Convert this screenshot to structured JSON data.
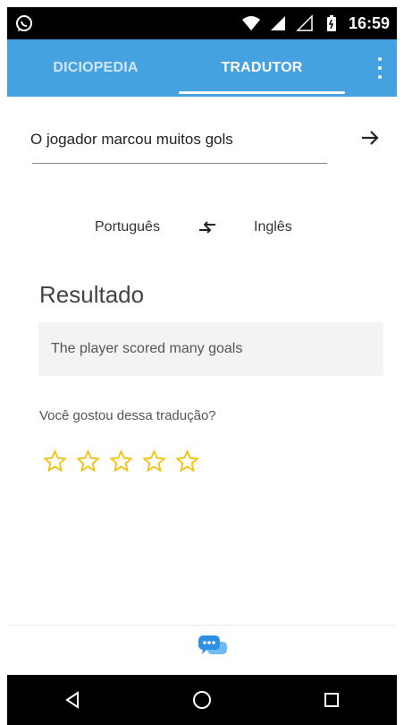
{
  "status_bar": {
    "time": "16:59",
    "icons": [
      "whatsapp-icon",
      "wifi-icon",
      "signal-icon",
      "empty-signal-icon",
      "battery-icon"
    ]
  },
  "header": {
    "tabs": [
      {
        "label": "DICIOPEDIA",
        "active": false
      },
      {
        "label": "TRADUTOR",
        "active": true
      }
    ],
    "menu_icon": "more-vert-icon",
    "accent_color": "#45a1e0"
  },
  "translator": {
    "input_value": "O jogador marcou muitos gols",
    "submit_icon": "arrow-right-icon",
    "source_language": "Português",
    "swap_icon": "swap-icon",
    "target_language": "Inglês",
    "result_title": "Resultado",
    "result_text": "The player scored many goals",
    "feedback_question": "Você gostou dessa tradução?",
    "rating": {
      "max": 5,
      "selected": 0,
      "star_color": "#f4c20d"
    }
  },
  "bottom_action": {
    "icon": "chat-bubbles-icon"
  },
  "nav": {
    "buttons": [
      "back-icon",
      "home-icon",
      "recents-icon"
    ]
  }
}
